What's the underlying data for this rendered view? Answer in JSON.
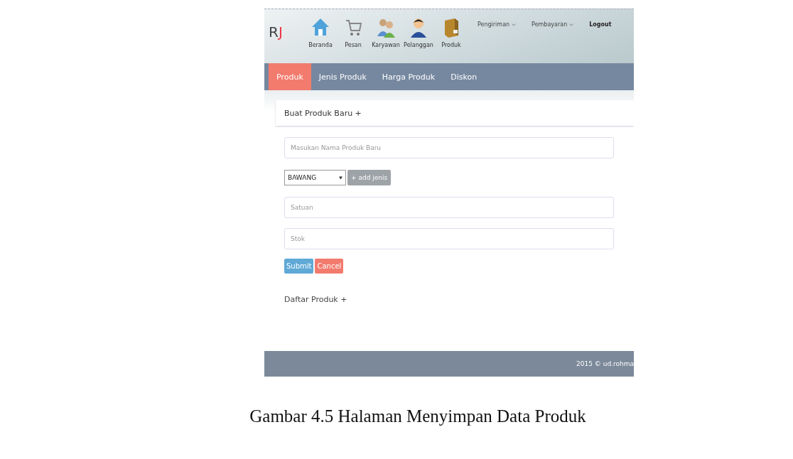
{
  "header": {
    "logo": {
      "text": "R",
      "accent": "J"
    },
    "nav": [
      {
        "kind": "house",
        "label": "Beranda"
      },
      {
        "kind": "cart",
        "label": "Pesan"
      },
      {
        "kind": "people",
        "label": "Karyawan"
      },
      {
        "kind": "person",
        "label": "Pelanggan"
      },
      {
        "kind": "box",
        "label": "Produk"
      }
    ],
    "menus": [
      {
        "kind": "dropdown",
        "label": "Pengiriman"
      },
      {
        "kind": "dropdown",
        "label": "Pembayaran"
      },
      {
        "kind": "link",
        "label": "Logout"
      }
    ]
  },
  "tabs": [
    {
      "label": "Produk",
      "selected": true
    },
    {
      "label": "Jenis Produk",
      "selected": false
    },
    {
      "label": "Harga Produk",
      "selected": false
    },
    {
      "label": "Diskon",
      "selected": false
    }
  ],
  "form": {
    "title": "Buat Produk Baru +",
    "fields": [
      {
        "kind": "input",
        "placeholder": "Masukan Nama Produk Baru"
      },
      {
        "kind": "select",
        "value": "BAWANG",
        "button": "+ add jenis",
        "button_disabled": true
      },
      {
        "kind": "input",
        "placeholder": "Satuan"
      },
      {
        "kind": "input",
        "placeholder": "Stok"
      }
    ],
    "buttons": [
      {
        "kind": "primary",
        "label": "Submit"
      },
      {
        "kind": "danger",
        "label": "Cancel"
      }
    ]
  },
  "list_title": "Daftar Produk +",
  "footer": "2015 © ud.rohma",
  "caption": "Gambar 4.5  Halaman Menyimpan Data Produk"
}
